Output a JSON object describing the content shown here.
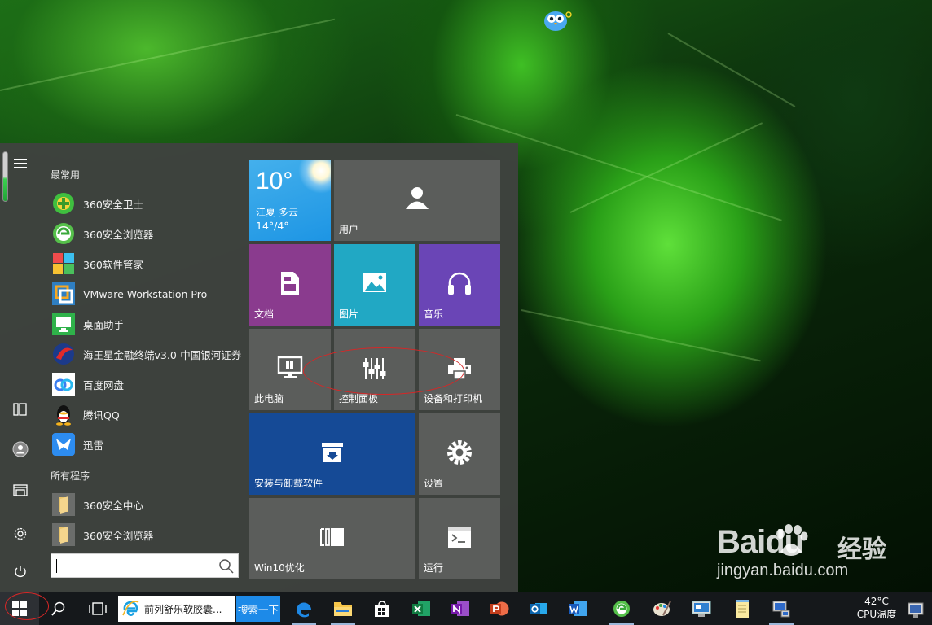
{
  "colors": {
    "menu_bg": "#3f423f",
    "tile_default": "#5b5d5b",
    "tile_weather": "#1d95e4",
    "tile_docs": "#8a3b8e",
    "tile_pics": "#21a8c4",
    "tile_music": "#6a45b6",
    "tile_uninstall": "#154a96",
    "taskbar_bg": "#15181b",
    "annotation": "#d62727"
  },
  "watermark": {
    "logo_text": "Baidu",
    "cn_text": "经验",
    "url": "jingyan.baidu.com"
  },
  "start_menu": {
    "rail": [
      {
        "name": "hamburger-menu-icon"
      },
      {
        "name": "tablet-mode-icon"
      },
      {
        "name": "user-icon"
      },
      {
        "name": "file-explorer-icon"
      },
      {
        "name": "settings-gear-icon"
      },
      {
        "name": "power-icon"
      }
    ],
    "most_used_label": "最常用",
    "most_used": [
      {
        "label": "360安全卫士",
        "icon": "360-safe-guard-icon"
      },
      {
        "label": "360安全浏览器",
        "icon": "360-browser-icon"
      },
      {
        "label": "360软件管家",
        "icon": "360-software-manager-icon"
      },
      {
        "label": "VMware Workstation Pro",
        "icon": "vmware-icon"
      },
      {
        "label": "桌面助手",
        "icon": "desktop-assistant-icon"
      },
      {
        "label": "海王星金融终端v3.0-中国银河证券",
        "icon": "neptune-finance-icon"
      },
      {
        "label": "百度网盘",
        "icon": "baidu-netdisk-icon"
      },
      {
        "label": "腾讯QQ",
        "icon": "qq-penguin-icon"
      },
      {
        "label": "迅雷",
        "icon": "xunlei-icon"
      }
    ],
    "all_programs_label": "所有程序",
    "all_programs": [
      {
        "label": "360安全中心",
        "icon": "folder-icon"
      },
      {
        "label": "360安全浏览器",
        "icon": "folder-icon"
      }
    ],
    "search": {
      "value": "",
      "placeholder": ""
    }
  },
  "tiles": {
    "weather": {
      "temp": "10°",
      "city": "江夏 多云",
      "range": "14°/4°"
    },
    "user": {
      "label": "用户"
    },
    "documents": {
      "label": "文档"
    },
    "pictures": {
      "label": "图片"
    },
    "music": {
      "label": "音乐"
    },
    "this_pc": {
      "label": "此电脑"
    },
    "control_panel": {
      "label": "控制面板"
    },
    "devices_printers": {
      "label": "设备和打印机"
    },
    "uninstall": {
      "label": "安装与卸载软件"
    },
    "settings": {
      "label": "设置"
    },
    "win10_optimize": {
      "label": "Win10优化"
    },
    "run": {
      "label": "运行"
    }
  },
  "taskbar": {
    "ie_window_title": "前列舒乐软胶囊...",
    "search_button": "搜索一下",
    "pinned": [
      "edge-icon",
      "file-explorer-icon",
      "store-icon",
      "excel-icon",
      "onenote-icon",
      "powerpoint-icon",
      "outlook-icon",
      "word-icon",
      "360-browser-icon",
      "paint-icon",
      "remote-desktop-icon",
      "notepad-icon",
      "network-icon"
    ],
    "cpu_temp": "42°C",
    "cpu_label": "CPU温度"
  }
}
